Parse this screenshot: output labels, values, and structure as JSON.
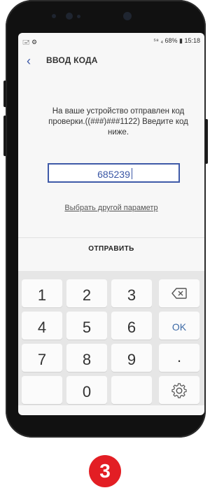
{
  "status": {
    "left": "🖃 ⚙",
    "right": "⁵⁸ ₄ 68% ▮ 15:18"
  },
  "header": {
    "title": "ВВОД КОДА"
  },
  "message": "На ваше устройство отправлен код проверки.((###)###1122) Введите код ниже.",
  "code": {
    "value": "685239"
  },
  "other_option_label": "Выбрать другой параметр",
  "send_label": "ОТПРАВИТЬ",
  "keyboard": {
    "keys": [
      "1",
      "2",
      "3",
      "4",
      "5",
      "6",
      "7",
      "8",
      "9",
      "",
      "0"
    ],
    "ok_label": "OK",
    "dot_label": ".",
    "icons": {
      "backspace": "backspace-icon",
      "settings": "gear-icon"
    }
  },
  "step_badge": "3",
  "colors": {
    "accent": "#3f5aa8",
    "badge": "#e31e24",
    "keyboard_bg": "#e6e6e6"
  }
}
